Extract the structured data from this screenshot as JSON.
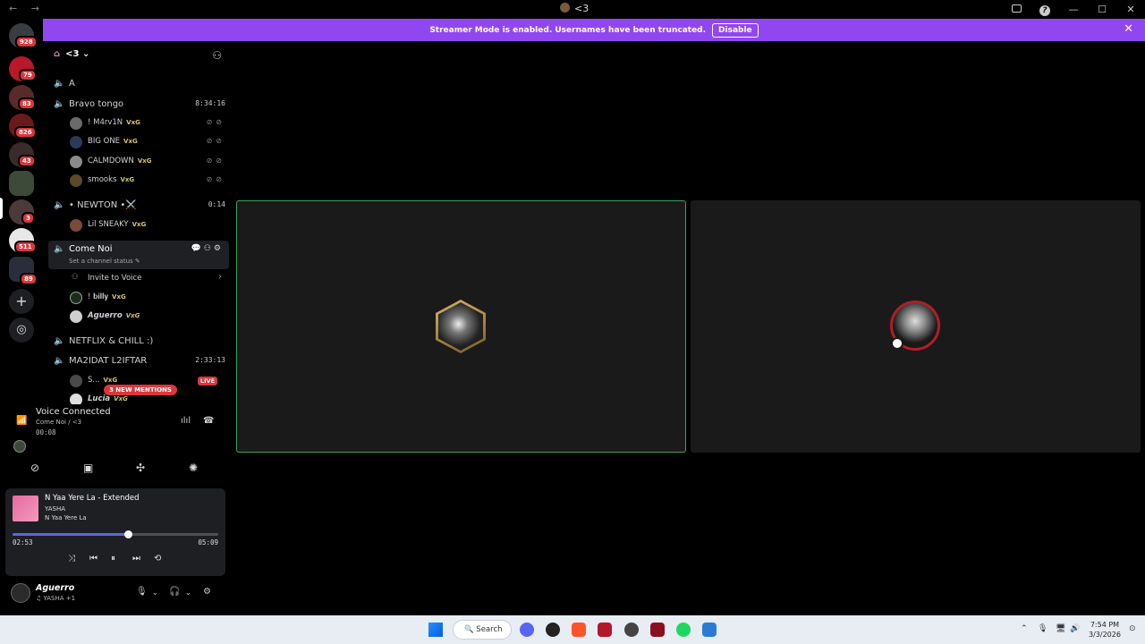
{
  "titlebar": {
    "back": "←",
    "forward": "→",
    "server_name": "<3"
  },
  "guilds": {
    "dm_badge": "928",
    "badges": [
      "79",
      "83",
      "826",
      "43",
      "3",
      "511",
      "89"
    ],
    "add_icon": "plus-icon",
    "explore_icon": "compass-icon"
  },
  "banner": {
    "text": "Streamer Mode is enabled. Usernames have been truncated.",
    "disable_label": "Disable",
    "close": "✕",
    "color": "#9147f0"
  },
  "server": {
    "name": "<3",
    "chevron": "⌄"
  },
  "channels": [
    {
      "name": "A",
      "time": ""
    },
    {
      "name": "Bravo tongo",
      "time": "8:34:16"
    },
    {
      "name": "• NEWTON •⚔️",
      "time": "0:14"
    },
    {
      "name": "Come Noi",
      "time": ""
    },
    {
      "name": "NETFLIX & CHILL :)",
      "time": ""
    },
    {
      "name": "MA2IDAT L2IFTAR",
      "time": "2:33:13"
    }
  ],
  "bravo_members": [
    {
      "name": "! M4rv1N",
      "tag": "VxG"
    },
    {
      "name": "BIG ONE",
      "tag": "VxG"
    },
    {
      "name": "CALMDOWN",
      "tag": "VxG"
    },
    {
      "name": "smooks",
      "tag": "VxG"
    }
  ],
  "newton_members": [
    {
      "name": "Lil SNEAKY",
      "tag": "VxG"
    }
  ],
  "active_channel": {
    "status": "Set a channel status ✎"
  },
  "invite": {
    "label": "Invite to Voice",
    "arrow": "›"
  },
  "comenoi_members": [
    {
      "name": "! 𝐛𝐢𝐥𝐥𝐲",
      "tag": "VxG"
    },
    {
      "name": "𝘼𝙜𝙪𝙚𝙧𝙧𝙤",
      "tag": "VxG"
    }
  ],
  "ma2idat_members": [
    {
      "name": "S...",
      "tag": "VxG",
      "live": "LIVE"
    },
    {
      "name": "𝙇𝙪𝙘𝙞𝙖",
      "tag": "VxG"
    }
  ],
  "new_mentions": "3 NEW MENTIONS",
  "voice": {
    "title": "Voice Connected",
    "channel": "Come Noi / <3",
    "elapsed": "00:08"
  },
  "music": {
    "title": "N Yaa Yere La - Extended",
    "artist": "YASHA",
    "album": "N Yaa Yere La",
    "current": "02:53",
    "total": "05:09",
    "progress": 0.56
  },
  "user": {
    "name": "𝘼𝙜𝙪𝙚𝙧𝙧𝙤",
    "status": "♫ YASHA +1"
  },
  "taskbar": {
    "search": "Search",
    "time": "7:54 PM",
    "date": "3/3/2026"
  }
}
